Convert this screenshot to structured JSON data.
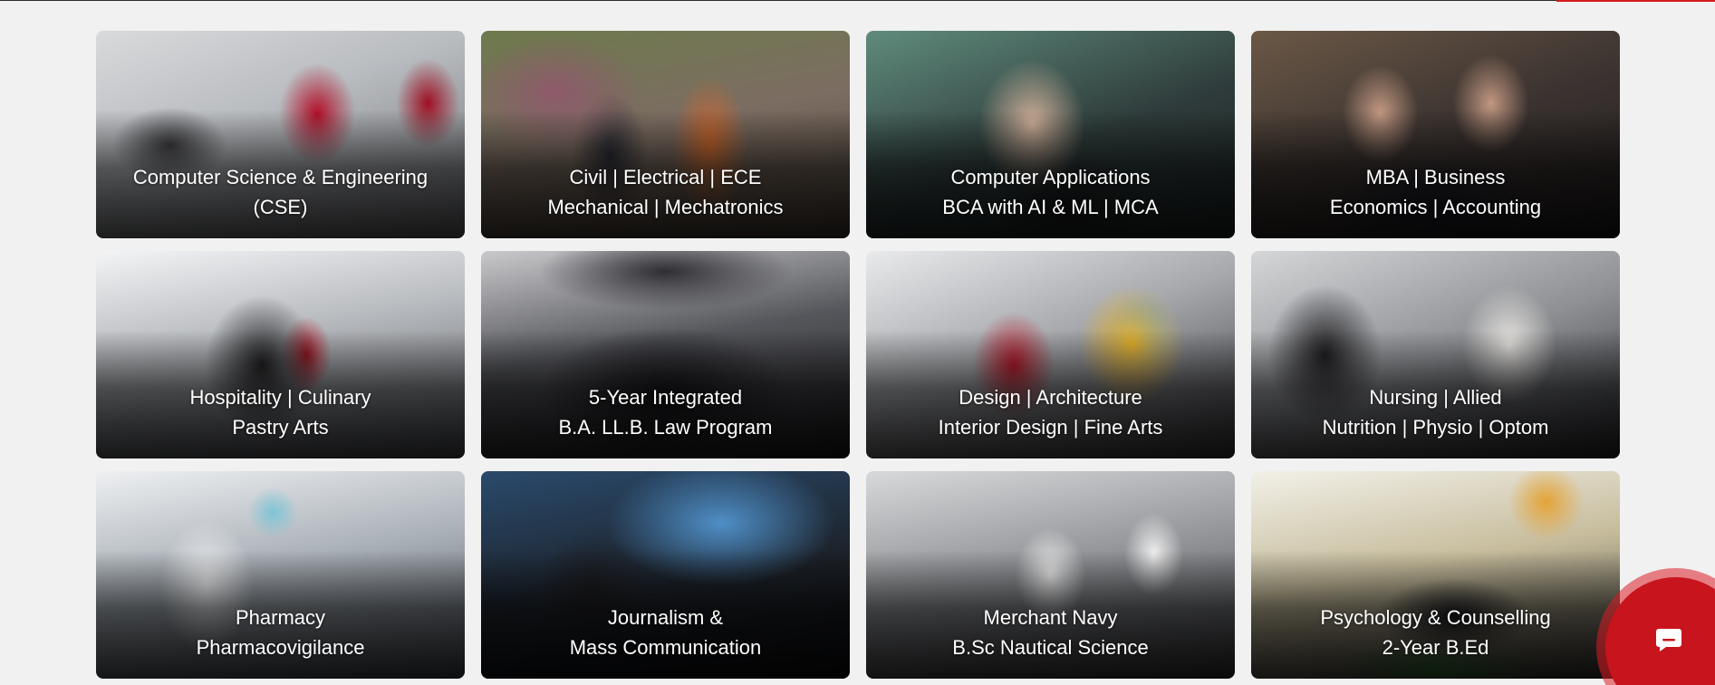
{
  "programs": [
    {
      "line1": "Computer Science & Engineering",
      "line2": "(CSE)"
    },
    {
      "line1": "Civil | Electrical | ECE",
      "line2": "Mechanical | Mechatronics"
    },
    {
      "line1": "Computer Applications",
      "line2": "BCA with AI & ML | MCA"
    },
    {
      "line1": "MBA | Business",
      "line2": "Economics | Accounting"
    },
    {
      "line1": "Hospitality | Culinary",
      "line2": "Pastry Arts"
    },
    {
      "line1": "5-Year Integrated",
      "line2": "B.A. LL.B. Law Program"
    },
    {
      "line1": "Design | Architecture",
      "line2": "Interior Design | Fine Arts"
    },
    {
      "line1": "Nursing | Allied",
      "line2": "Nutrition | Physio | Optom"
    },
    {
      "line1": "Pharmacy",
      "line2": "Pharmacovigilance"
    },
    {
      "line1": "Journalism &",
      "line2": "Mass Communication"
    },
    {
      "line1": "Merchant Navy",
      "line2": "B.Sc Nautical Science"
    },
    {
      "line1": "Psychology & Counselling",
      "line2": "2-Year B.Ed"
    }
  ],
  "chat_widget": {
    "icon": "chat-icon"
  },
  "colors": {
    "accent": "#d41b1b",
    "page_bg": "#f1f1f1",
    "caption_text": "#ffffff"
  }
}
